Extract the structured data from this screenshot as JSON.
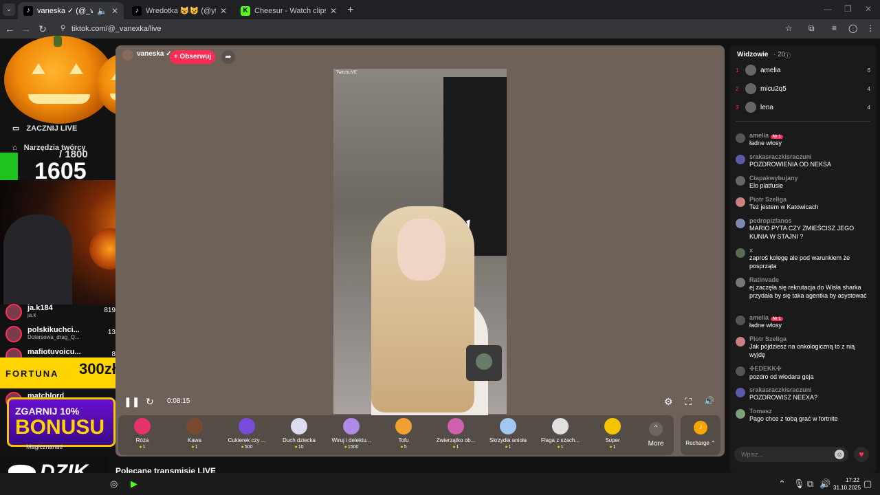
{
  "browser": {
    "tabs": [
      {
        "title": "vaneska ✓ (@_vanexka) pr",
        "active": true
      },
      {
        "title": "Wredotka 😺😺 (@yttre.uuty)",
        "active": false
      },
      {
        "title": "Cheesur - Watch clips on Kick",
        "active": false
      }
    ],
    "url": "tiktok.com/@_vanexka/live",
    "new_tab": "+",
    "close_glyph": "✕"
  },
  "left_nav": {
    "items": [
      {
        "icon": "video-camera-icon",
        "label": "ZACZNIJ LIVE"
      },
      {
        "icon": "house-icon",
        "label": "Narzędzia twórcy"
      }
    ],
    "goal_total": "/ 1800",
    "goal_current": "1605",
    "creators": [
      {
        "name": "ja.k184",
        "sub": "ja.k",
        "count": "819"
      },
      {
        "name": "polskikuchci...",
        "sub": "Dolarsowa_drag_Q...",
        "count": "13"
      },
      {
        "name": "mafiotuvoicu...",
        "sub": "",
        "count": "8"
      },
      {
        "name": "matchlord",
        "sub": "",
        "count": ""
      },
      {
        "name": "Magicznanati",
        "sub": "",
        "count": ""
      }
    ],
    "fortuna_label": "FORTUNA",
    "fortuna_amount": "300zł",
    "bonus_top": "ZGARNIJ 10%",
    "bonus_main": "BONUSU",
    "dzik": "DZIK"
  },
  "player": {
    "streamer": "vaneska ✓",
    "follow": "+ Obserwuj",
    "share_glyph": "➦",
    "watermark": "TwitchLIVE",
    "pause_glyph": "❚❚",
    "refresh_glyph": "↻",
    "elapsed": "0:08:15",
    "settings_glyph": "⚙",
    "fullscreen_glyph": "⛶",
    "volume_glyph": "🔊"
  },
  "gifts": [
    {
      "name": "Róża",
      "price": "1",
      "color": "#e8336a"
    },
    {
      "name": "Kawa",
      "price": "1",
      "color": "#7a4a30"
    },
    {
      "name": "Cukierek czy ...",
      "price": "500",
      "color": "#7a4ad8"
    },
    {
      "name": "Duch dziecka",
      "price": "10",
      "color": "#dcdcf0"
    },
    {
      "name": "Wiruj i delektu...",
      "price": "1500",
      "color": "#b08ae8"
    },
    {
      "name": "Tofu",
      "price": "5",
      "color": "#f0a030"
    },
    {
      "name": "Zwierzątko ob...",
      "price": "1",
      "color": "#d060b0"
    },
    {
      "name": "Skrzydła anioła",
      "price": "1",
      "color": "#a0c8f0"
    },
    {
      "name": "Flaga z szach...",
      "price": "1",
      "color": "#e0e0e0"
    },
    {
      "name": "Super",
      "price": "1",
      "color": "#f5c400"
    }
  ],
  "more_label": "More",
  "more_glyph": "⌃",
  "recharge_label": "Recharge ⌃",
  "recharge_glyph": "♪",
  "recommended": "Polecane transmisje LIVE",
  "viewers": {
    "title": "Widzowie",
    "count": "· 20",
    "top": [
      {
        "rank": "1",
        "name": "amelia",
        "value": "6"
      },
      {
        "rank": "2",
        "name": "micu2q5",
        "value": "4"
      },
      {
        "rank": "3",
        "name": "lena",
        "value": "4"
      }
    ]
  },
  "chat": [
    {
      "user": "amelia",
      "badge": "Nr 1",
      "text": "ładne włosy"
    },
    {
      "user": "srakasraczkisraczuni",
      "badge": "",
      "text": "POZDROWIENIA OD NEKSA"
    },
    {
      "user": "Ciapakwybujany",
      "badge": "",
      "text": "Elo platfusie"
    },
    {
      "user": "Piotr Szeliga",
      "badge": "",
      "text": "Też jestem w Katowicach"
    },
    {
      "user": "pedropizfanos",
      "badge": "",
      "text": "MARIO PYTA CZY ZMIEŚCISZ JEGO KUNIA W STAJNI ?"
    },
    {
      "user": "x",
      "badge": "",
      "text": "zaproś kolegę ale pod warunkiem że posprząta"
    },
    {
      "user": "Ratinvade",
      "badge": "",
      "text": "ej zaczęła się rekrutacja do Wisła sharka przydała by się taka agentka by asystować"
    },
    {
      "user": "amelia",
      "badge": "Nr 1",
      "text": "ładne włosy"
    },
    {
      "user": "Piotr Szeliga",
      "badge": "",
      "text": "Jak pójdziesz na onkologiczną to z nią wyjdę"
    },
    {
      "user": "✣EDEKK✣",
      "badge": "",
      "text": "pozdro od włodara geja"
    },
    {
      "user": "srakasraczkisraczuni",
      "badge": "",
      "text": "POZDROWISZ NEEXA?"
    },
    {
      "user": "Tomasz",
      "badge": "",
      "text": "Pago chce z tobą grać w fortnite"
    }
  ],
  "chat_input_placeholder": "Wpisz...",
  "chat_emoji_glyph": "☺",
  "chat_heart_glyph": "♥",
  "taskbar": {
    "time": "17:22",
    "date": "31.10.2025"
  }
}
